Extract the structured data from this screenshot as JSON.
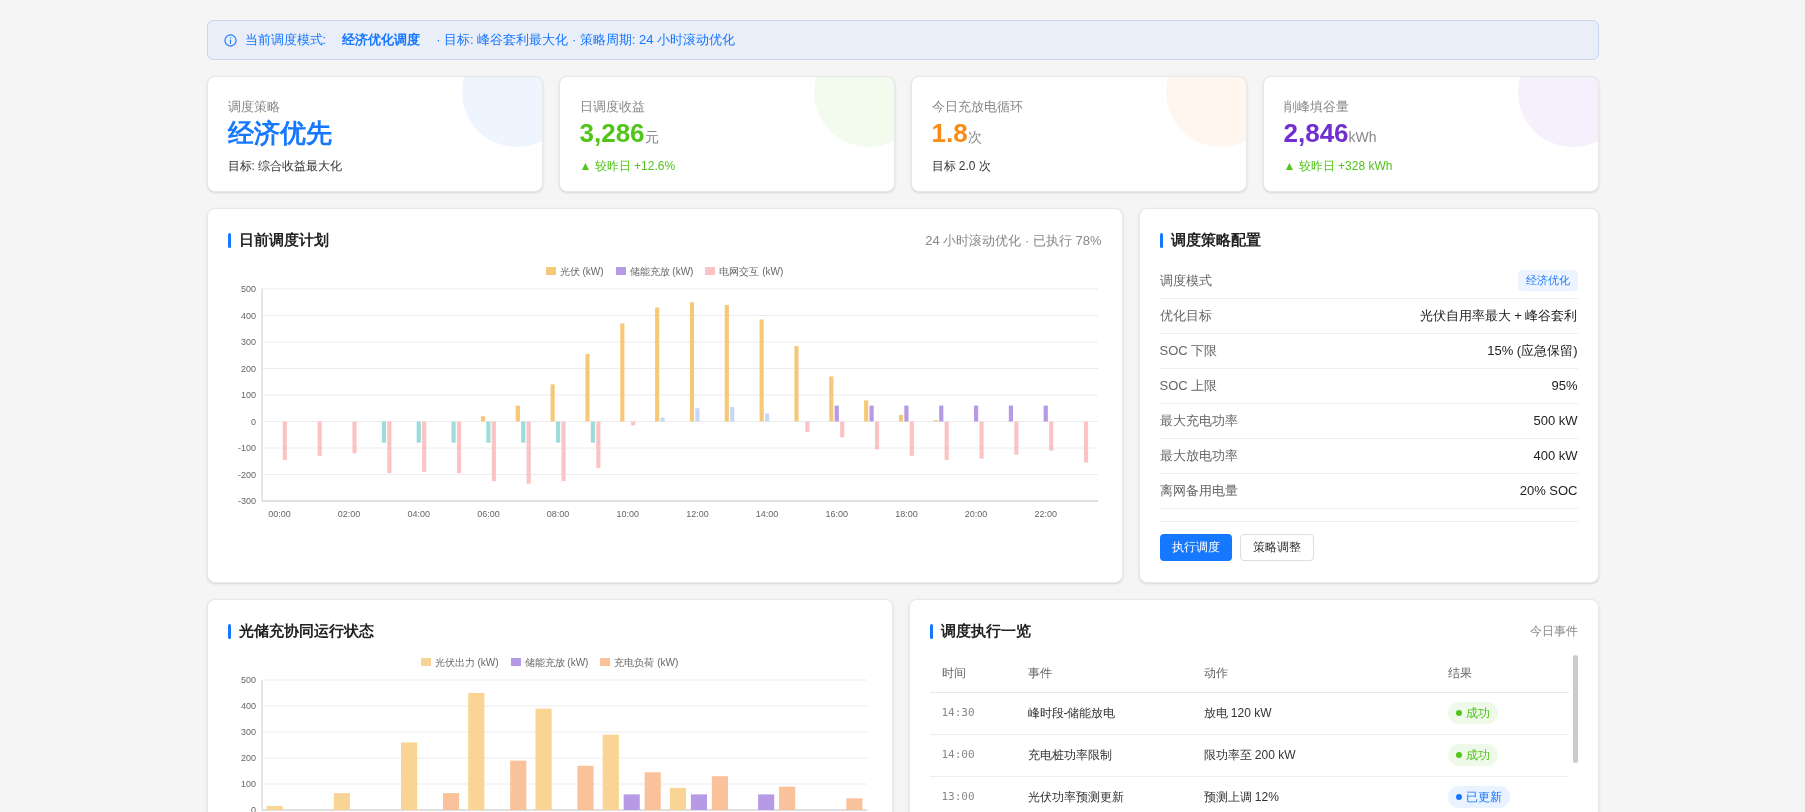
{
  "banner": {
    "label": "当前调度模式:",
    "mode": "经济优化调度",
    "detail": "· 目标: 峰谷套利最大化 · 策略周期: 24 小时滚动优化"
  },
  "kpis": [
    {
      "label": "调度策略",
      "value": "经济优先",
      "note": "目标: 综合收益最大化",
      "kind": "plain",
      "color": "#1677ff"
    },
    {
      "label": "日调度收益",
      "value": "3,286",
      "unit": "元",
      "note": "▲ 较昨日 +12.6%",
      "kind": "trend",
      "color": "#52c41a"
    },
    {
      "label": "今日充放电循环",
      "value": "1.8",
      "unit": "次",
      "note": "目标 2.0 次",
      "kind": "plain",
      "color": "#fa8c16"
    },
    {
      "label": "削峰填谷量",
      "value": "2,846",
      "unit": "kWh",
      "note": "▲ 较昨日 +328 kWh",
      "kind": "trend",
      "color": "#722ed1"
    }
  ],
  "plan": {
    "title": "日前调度计划",
    "subtitle": "24 小时滚动优化 · 已执行 78%",
    "chart_data": {
      "type": "bar",
      "legend": "top",
      "grid": true,
      "categories": [
        "00:00",
        null,
        "02:00",
        null,
        "04:00",
        null,
        "06:00",
        null,
        "08:00",
        null,
        "10:00",
        null,
        "12:00",
        null,
        "14:00",
        null,
        "16:00",
        null,
        "18:00",
        null,
        "20:00",
        null,
        "22:00",
        null
      ],
      "series": [
        {
          "name": "光伏 (kW)",
          "color": "#f6c97a",
          "values": [
            0,
            0,
            0,
            0,
            0,
            0,
            20,
            60,
            140,
            255,
            370,
            430,
            450,
            440,
            385,
            285,
            170,
            80,
            25,
            5,
            0,
            0,
            0,
            0
          ]
        },
        {
          "name": "储能充放 (kW)",
          "color": "#b79ae6",
          "values": [
            0,
            0,
            0,
            0,
            0,
            0,
            0,
            0,
            0,
            0,
            0,
            0,
            0,
            0,
            0,
            0,
            60,
            60,
            60,
            60,
            60,
            60,
            60,
            0
          ]
        },
        {
          "color": "#9edcdb",
          "values": [
            0,
            0,
            0,
            -80,
            -80,
            -80,
            -80,
            -80,
            -80,
            -80,
            0,
            0,
            0,
            0,
            0,
            0,
            0,
            0,
            0,
            0,
            0,
            0,
            0,
            0
          ]
        },
        {
          "color": "#c4d8f8",
          "values": [
            0,
            0,
            0,
            0,
            0,
            0,
            0,
            0,
            0,
            0,
            0,
            15,
            50,
            55,
            30,
            0,
            0,
            0,
            0,
            0,
            0,
            0,
            0,
            0
          ]
        },
        {
          "name": "电网交互 (kW)",
          "color": "#fbc4c4",
          "values": [
            -145,
            -130,
            -120,
            -195,
            -190,
            -195,
            -225,
            -235,
            -225,
            -175,
            -15,
            0,
            0,
            0,
            0,
            -40,
            -60,
            -105,
            -130,
            -145,
            -140,
            -125,
            -110,
            -155
          ]
        }
      ],
      "ylim": [
        -300,
        500
      ],
      "yticks": [
        -300,
        -200,
        -100,
        0,
        100,
        200,
        300,
        400,
        500
      ]
    }
  },
  "config": {
    "title": "调度策略配置",
    "rows": [
      {
        "label": "调度模式",
        "value": "经济优化",
        "kind": "tag"
      },
      {
        "label": "优化目标",
        "value": "光伏自用率最大 + 峰谷套利",
        "kind": "text"
      },
      {
        "label": "SOC 下限",
        "value": "15% (应急保留)",
        "kind": "text"
      },
      {
        "label": "SOC 上限",
        "value": "95%",
        "kind": "text"
      },
      {
        "label": "最大充电功率",
        "value": "500 kW",
        "kind": "text"
      },
      {
        "label": "最大放电功率",
        "value": "400 kW",
        "kind": "text"
      },
      {
        "label": "离网备用电量",
        "value": "20% SOC",
        "kind": "text"
      }
    ],
    "buttons": [
      {
        "label": "执行调度",
        "kind": "primary"
      },
      {
        "label": "策略调整",
        "kind": "secondary"
      }
    ]
  },
  "coop": {
    "title": "光储充协同运行状态",
    "chart_data": {
      "type": "bar",
      "legend": "top",
      "grid": true,
      "series": [
        {
          "name": "光伏出力 (kW)",
          "color": "#f9d494",
          "values": [
            15,
            65,
            260,
            450,
            390,
            290,
            85,
            null,
            null
          ]
        },
        {
          "name": "储能充放 (kW)",
          "color": "#b79ae6",
          "values": [
            null,
            null,
            null,
            null,
            null,
            60,
            60,
            60,
            null
          ]
        },
        {
          "name": "充电负荷 (kW)",
          "color": "#f9c29b",
          "values": [
            null,
            null,
            65,
            190,
            170,
            145,
            130,
            90,
            45
          ]
        }
      ],
      "ylim": [
        0,
        500
      ],
      "yticks": [
        0,
        100,
        200,
        300,
        400,
        500
      ]
    }
  },
  "log": {
    "title": "调度执行一览",
    "subtitle": "今日事件",
    "columns": [
      "时间",
      "事件",
      "动作",
      "结果"
    ],
    "rows": [
      {
        "time": "14:30",
        "event": "峰时段-储能放电",
        "action": "放电 120 kW",
        "result": "成功",
        "color": "#52c41a"
      },
      {
        "time": "14:00",
        "event": "充电桩功率限制",
        "action": "限功率至 200 kW",
        "result": "成功",
        "color": "#52c41a"
      },
      {
        "time": "13:00",
        "event": "光伏功率预测更新",
        "action": "预测上调 12%",
        "result": "已更新",
        "color": "#1677ff"
      }
    ]
  }
}
